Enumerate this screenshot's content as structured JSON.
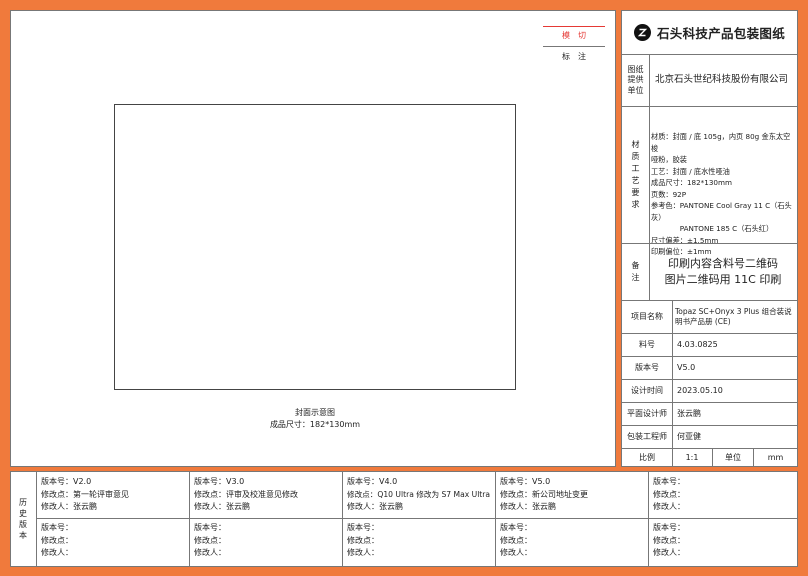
{
  "die_cut_legend": {
    "cut_label": "模　切",
    "cut_line_color": "#e53935",
    "annotation_label": "标　注"
  },
  "preview": {
    "caption_title": "封面示意图",
    "caption_size": "成品尺寸：182*130mm"
  },
  "brand": {
    "logo_icon": "stone-logo-icon",
    "title": "石头科技产品包装图纸"
  },
  "supplier": {
    "label": "图纸提供单位",
    "value": "北京石头世纪科技股份有限公司"
  },
  "requirements": {
    "label": "材质工艺要求",
    "lines": [
      "材质：封面 / 底 105g，内页 80g 金东太空梭",
      "哑粉，胶装",
      "工艺：封面 / 底水性哑油",
      "成品尺寸：182*130mm",
      "页数：92P",
      "参考色：PANTONE Cool Gray 11 C（石头灰）",
      "　　　　PANTONE 185 C（石头红）",
      "尺寸偏差：±1.5mm",
      "印刷偏位：±1mm"
    ]
  },
  "remarks": {
    "label": "备注",
    "lines": [
      "印刷内容含料号二维码",
      "图片二维码用 11C 印刷"
    ]
  },
  "info_rows": [
    {
      "label": "项目名称",
      "value": "Topaz SC+Onyx 3 Plus 组合装说明书产品册 (CE)"
    },
    {
      "label": "料号",
      "value": "4.03.0825"
    },
    {
      "label": "版本号",
      "value": "V5.0"
    },
    {
      "label": "设计时间",
      "value": "2023.05.10"
    },
    {
      "label": "平面设计师",
      "value": "张云鹏"
    },
    {
      "label": "包装工程师",
      "value": "何亚健"
    }
  ],
  "scale_row": {
    "label": "比例",
    "value": "1:1",
    "unit_label": "单位",
    "unit_value": "mm"
  },
  "history": {
    "label": "历史版本",
    "top_row": [
      {
        "version": "版本号：V2.0",
        "change": "修改点：第一轮评审意见",
        "editor": "修改人：张云鹏"
      },
      {
        "version": "版本号：V3.0",
        "change": "修改点：评审及校准意见修改",
        "editor": "修改人：张云鹏"
      },
      {
        "version": "版本号：V4.0",
        "change": "修改点：Q10 Ultra 修改为 S7 Max Ultra",
        "editor": "修改人：张云鹏"
      },
      {
        "version": "版本号：V5.0",
        "change": "修改点：新公司地址变更",
        "editor": "修改人：张云鹏"
      },
      {
        "version": "版本号：",
        "change": "修改点：",
        "editor": "修改人："
      }
    ],
    "bottom_row": [
      {
        "version": "版本号：",
        "change": "修改点：",
        "editor": "修改人："
      },
      {
        "version": "版本号：",
        "change": "修改点：",
        "editor": "修改人："
      },
      {
        "version": "版本号：",
        "change": "修改点：",
        "editor": "修改人："
      },
      {
        "version": "版本号：",
        "change": "修改点：",
        "editor": "修改人："
      },
      {
        "version": "版本号：",
        "change": "修改点：",
        "editor": "修改人："
      }
    ]
  }
}
